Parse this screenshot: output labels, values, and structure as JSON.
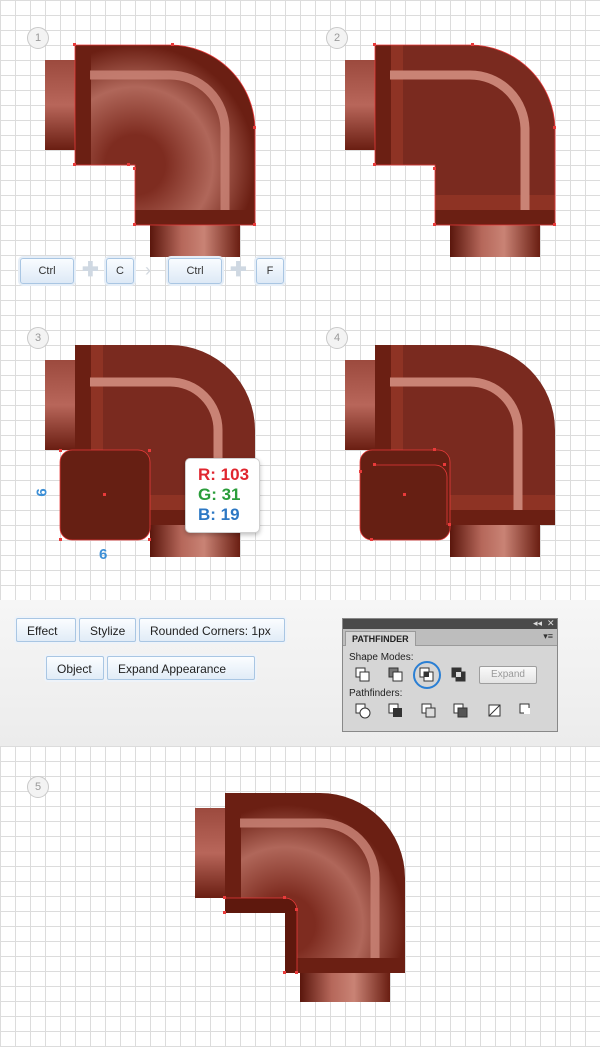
{
  "steps": [
    "1",
    "2",
    "3",
    "4",
    "5"
  ],
  "shortcuts": {
    "keys": [
      "Ctrl",
      "C",
      "Ctrl",
      "F"
    ]
  },
  "color_tooltip": {
    "r": "R: 103",
    "g": "G: 31",
    "b": "B: 19",
    "r_color": "#e0262f",
    "g_color": "#2a9d3a",
    "b_color": "#2d78c4"
  },
  "dimensions": {
    "width": "6",
    "height": "6"
  },
  "menu_path": {
    "effect": "Effect",
    "stylize": "Stylize",
    "rounded_corners": "Rounded Corners: 1px",
    "object": "Object",
    "expand_appearance": "Expand Appearance"
  },
  "pathfinder": {
    "title": "PATHFINDER",
    "shape_modes_label": "Shape Modes:",
    "pathfinders_label": "Pathfinders:",
    "expand_label": "Expand",
    "shape_mode_icons": [
      "unite-icon",
      "minus-front-icon",
      "intersect-icon",
      "exclude-icon"
    ],
    "pathfinder_icons": [
      "divide-icon",
      "trim-icon",
      "merge-icon",
      "crop-icon",
      "outline-icon",
      "minus-back-icon"
    ],
    "selected_shape_mode": "intersect-icon"
  },
  "colors": {
    "pipe_dark": "#6b1f13",
    "pipe_body": "#7a2a1f",
    "pipe_light": "#a95a4c",
    "stripe": "#c98375",
    "anchor": "#e83a3a",
    "accent_blue": "#3d8fd6"
  }
}
